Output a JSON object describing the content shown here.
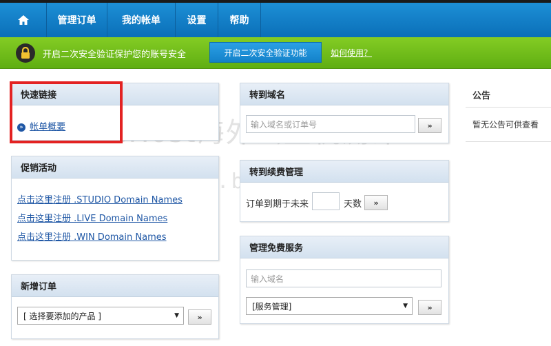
{
  "topnav": {
    "home_icon": "home-icon",
    "items": [
      "管理订单",
      "我的帐单",
      "设置",
      "帮助"
    ]
  },
  "security": {
    "icon": "lock-icon",
    "text": "开启二次安全验证保护您的账号安全",
    "button": "开启二次安全验证功能",
    "link": "如何使用？"
  },
  "quick_links": {
    "title": "快速链接",
    "icon": "circle-arrow-icon",
    "link": "帐单概要"
  },
  "promotions": {
    "title": "促销活动",
    "links": [
      "点击这里注册 .STUDIO Domain Names",
      "点击这里注册 .LIVE Domain Names",
      "点击这里注册 .WIN Domain Names"
    ]
  },
  "new_order": {
    "title": "新增订单",
    "select": "[ 选择要添加的产品 ]",
    "go": "»"
  },
  "goto_domain": {
    "title": "转到域名",
    "placeholder": "输入域名或订单号",
    "go": "»"
  },
  "renewal": {
    "title": "转到续费管理",
    "label_before": "订单到期于未来",
    "label_after": "天数",
    "go": "»"
  },
  "free_services": {
    "title": "管理免费服务",
    "placeholder": "输入域名",
    "select": "[服务管理]",
    "go": "»"
  },
  "announcements": {
    "title": "公告",
    "empty": "暂无公告可供查看"
  },
  "watermark": {
    "line1": "BlueHost海外云主机测评",
    "line2": "http://www.bizhuji.com/"
  },
  "colors": {
    "nav_blue": "#0a6fb8",
    "security_green": "#6bbd18",
    "link_blue": "#1f57a5",
    "highlight_red": "#e32222"
  }
}
